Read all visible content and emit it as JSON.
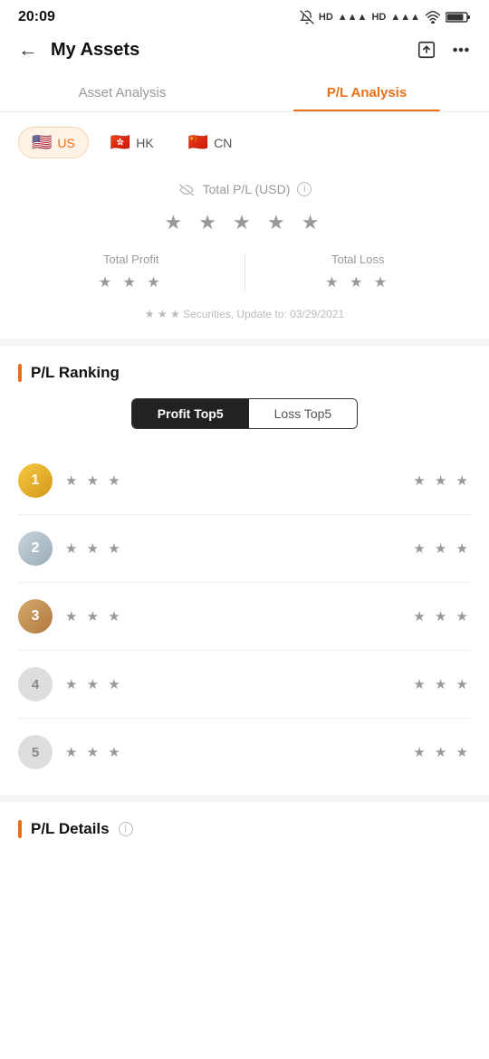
{
  "statusBar": {
    "time": "20:09",
    "icons": "🔕 HD HD ▲▲▲ ▲▲▲ ⊛ 🔋"
  },
  "header": {
    "title": "My Assets",
    "backLabel": "←",
    "shareIcon": "share",
    "moreIcon": "more"
  },
  "tabs": [
    {
      "id": "asset",
      "label": "Asset Analysis",
      "active": false
    },
    {
      "id": "pl",
      "label": "P/L Analysis",
      "active": true
    }
  ],
  "regions": [
    {
      "id": "us",
      "label": "US",
      "flag": "🇺🇸",
      "active": true
    },
    {
      "id": "hk",
      "label": "HK",
      "flag": "🇭🇰",
      "active": false
    },
    {
      "id": "cn",
      "label": "CN",
      "flag": "🇨🇳",
      "active": false
    }
  ],
  "plSummary": {
    "eyeIconLabel": "hide",
    "totalLabel": "Total P/L (USD)",
    "infoLabel": "i",
    "mainStars": "★ ★ ★ ★ ★",
    "totalProfit": {
      "label": "Total Profit",
      "stars": "★ ★ ★"
    },
    "totalLoss": {
      "label": "Total Loss",
      "stars": "★ ★ ★"
    },
    "updateNote": "★ ★ ★ Securities, Update to: 03/29/2021"
  },
  "ranking": {
    "sectionTitle": "P/L Ranking",
    "toggleButtons": [
      {
        "id": "profit",
        "label": "Profit Top5",
        "active": true
      },
      {
        "id": "loss",
        "label": "Loss Top5",
        "active": false
      }
    ],
    "items": [
      {
        "rank": 1,
        "nameStars": "★ ★ ★",
        "valueStars": "★ ★ ★"
      },
      {
        "rank": 2,
        "nameStars": "★ ★ ★",
        "valueStars": "★ ★ ★"
      },
      {
        "rank": 3,
        "nameStars": "★ ★ ★",
        "valueStars": "★ ★ ★"
      },
      {
        "rank": 4,
        "nameStars": "★ ★ ★",
        "valueStars": "★ ★ ★"
      },
      {
        "rank": 5,
        "nameStars": "★ ★ ★",
        "valueStars": "★ ★ ★"
      }
    ]
  },
  "plDetails": {
    "sectionTitle": "P/L Details",
    "infoLabel": "i"
  },
  "colors": {
    "accent": "#e8701a",
    "dark": "#222",
    "muted": "#999",
    "light": "#f5f5f5"
  }
}
